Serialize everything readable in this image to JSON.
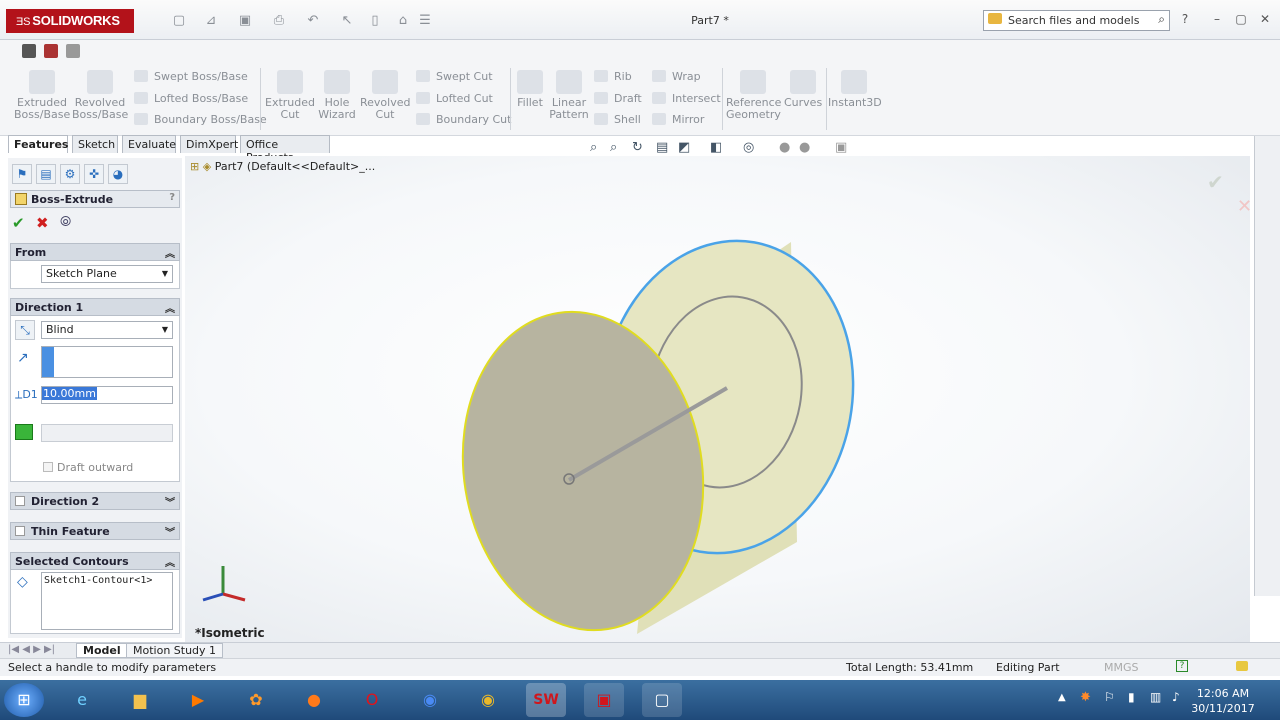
{
  "app": {
    "name": "SOLIDWORKS",
    "doc_title": "Part7 *"
  },
  "search": {
    "placeholder": "Search files and models"
  },
  "ribbon": {
    "extrude": "Extruded Boss/Base",
    "revolve": "Revolved Boss/Base",
    "swept": "Swept Boss/Base",
    "lofted": "Lofted Boss/Base",
    "boundary": "Boundary Boss/Base",
    "excut": "Extruded Cut",
    "hole": "Hole Wizard",
    "revcut": "Revolved Cut",
    "sweptcut": "Swept Cut",
    "loftedcut": "Lofted Cut",
    "boundarycut": "Boundary Cut",
    "fillet": "Fillet",
    "linpat": "Linear Pattern",
    "rib": "Rib",
    "draft": "Draft",
    "shell": "Shell",
    "wrap": "Wrap",
    "intersect": "Intersect",
    "mirror": "Mirror",
    "refgeo": "Reference Geometry",
    "curves": "Curves",
    "instant3d": "Instant3D"
  },
  "tabs": [
    "Features",
    "Sketch",
    "Evaluate",
    "DimXpert",
    "Office Products"
  ],
  "tree": {
    "label": "Part7  (Default<<Default>_..."
  },
  "feature": {
    "title": "Boss-Extrude",
    "from": {
      "title": "From",
      "value": "Sketch Plane"
    },
    "dir1": {
      "title": "Direction 1",
      "type": "Blind",
      "depth": "10.00mm",
      "draft": "Draft outward"
    },
    "dir2": {
      "title": "Direction 2"
    },
    "thin": {
      "title": "Thin Feature"
    },
    "contours": {
      "title": "Selected Contours",
      "item": "Sketch1-Contour<1>"
    }
  },
  "view": {
    "label": "*Isometric"
  },
  "bottom_tabs": [
    "Model",
    "Motion Study 1"
  ],
  "status": {
    "message": "Select a handle to modify parameters",
    "length": "Total Length: 53.41mm",
    "mode": "Editing Part",
    "units": "MMGS"
  },
  "clock": {
    "time": "12:06 AM",
    "date": "30/11/2017"
  }
}
